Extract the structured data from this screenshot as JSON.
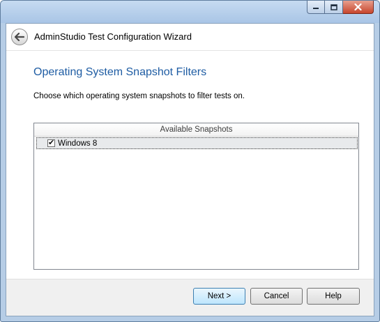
{
  "window": {
    "title": "AdminStudio Test Configuration Wizard"
  },
  "page": {
    "heading": "Operating System Snapshot Filters",
    "instruction": "Choose which operating system snapshots to filter tests on."
  },
  "snapshots": {
    "column_header": "Available Snapshots",
    "items": [
      {
        "label": "Windows 8",
        "checked": true
      }
    ]
  },
  "buttons": {
    "next": "Next >",
    "cancel": "Cancel",
    "help": "Help"
  },
  "colors": {
    "heading": "#1e5ca3",
    "frame": "#b6cde6",
    "close_button": "#c7462d"
  },
  "icons": {
    "back": "back-arrow-icon",
    "minimize": "minimize-icon",
    "maximize": "maximize-icon",
    "close": "close-icon",
    "check": "checkmark-icon"
  }
}
